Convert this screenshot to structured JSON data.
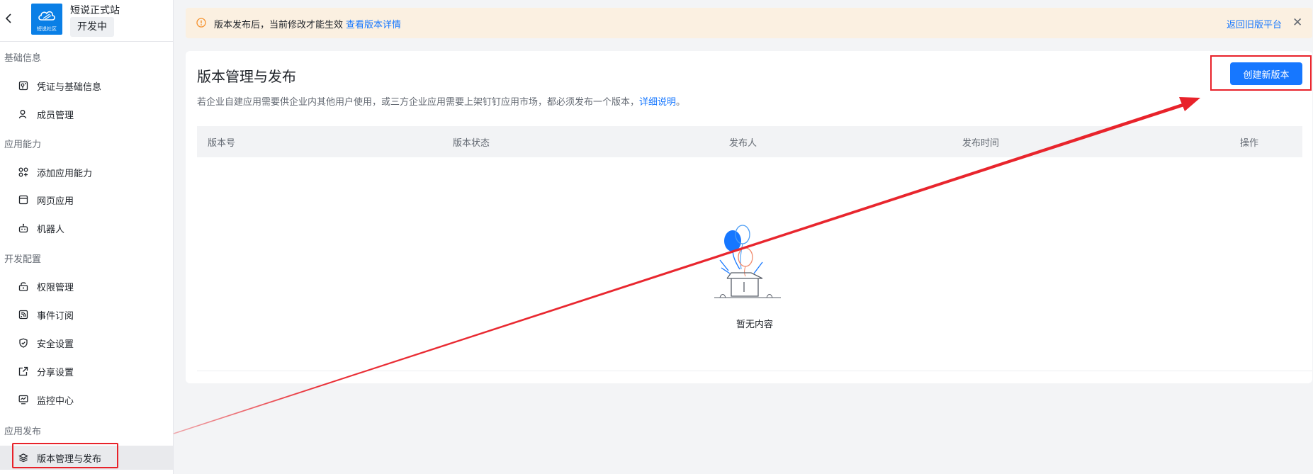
{
  "app": {
    "name": "短说正式站",
    "status": "开发中",
    "logo_text": "短说社区"
  },
  "sidebar": {
    "groups": [
      {
        "title": "基础信息",
        "items": [
          {
            "label": "凭证与基础信息",
            "icon": "credential-icon"
          },
          {
            "label": "成员管理",
            "icon": "user-icon"
          }
        ]
      },
      {
        "title": "应用能力",
        "items": [
          {
            "label": "添加应用能力",
            "icon": "grid-plus-icon"
          },
          {
            "label": "网页应用",
            "icon": "browser-icon"
          },
          {
            "label": "机器人",
            "icon": "robot-icon"
          }
        ]
      },
      {
        "title": "开发配置",
        "items": [
          {
            "label": "权限管理",
            "icon": "lock-icon"
          },
          {
            "label": "事件订阅",
            "icon": "rss-icon"
          },
          {
            "label": "安全设置",
            "icon": "shield-icon"
          },
          {
            "label": "分享设置",
            "icon": "share-icon"
          },
          {
            "label": "监控中心",
            "icon": "monitor-icon"
          }
        ]
      },
      {
        "title": "应用发布",
        "items": [
          {
            "label": "版本管理与发布",
            "icon": "layers-icon",
            "active": true
          }
        ]
      }
    ]
  },
  "notice": {
    "text": "版本发布后，当前修改才能生效",
    "link": "查看版本详情",
    "back_link": "返回旧版平台",
    "close": "✕",
    "color": "#fbf0e1"
  },
  "page": {
    "title": "版本管理与发布",
    "description": "若企业自建应用需要供企业内其他用户使用，或三方企业应用需要上架钉钉应用市场，都必须发布一个版本，",
    "description_link": "详细说明",
    "description_end": "。",
    "create_button": "创建新版本",
    "table_headers": [
      "版本号",
      "版本状态",
      "发布人",
      "发布时间",
      "操作"
    ],
    "empty_text": "暂无内容"
  },
  "colors": {
    "accent": "#1677ff",
    "annotation_red": "#e8222a"
  }
}
